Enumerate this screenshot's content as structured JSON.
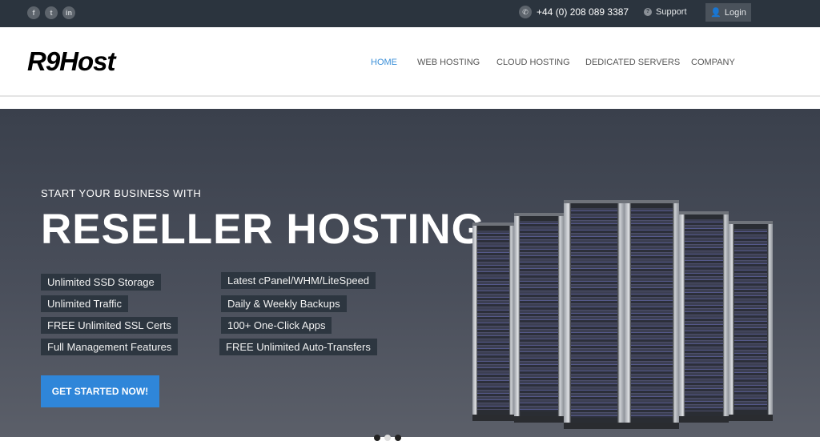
{
  "topbar": {
    "social": [
      {
        "icon": "facebook-icon",
        "glyph": "f"
      },
      {
        "icon": "twitter-icon",
        "glyph": "t"
      },
      {
        "icon": "linkedin-icon",
        "glyph": "in"
      }
    ],
    "phone": "+44 (0) 208 089 3387",
    "support": "Support",
    "login": "Login"
  },
  "header": {
    "logo": "R9Host",
    "nav": [
      "HOME",
      "WEB HOSTING",
      "CLOUD HOSTING",
      "DEDICATED SERVERS",
      "COMPANY"
    ],
    "active": "HOME",
    "accent": "#3b8fd8"
  },
  "hero": {
    "subtitle": "START YOUR BUSINESS WITH",
    "title": "RESELLER HOSTING",
    "features_left": [
      "Unlimited SSD Storage",
      "Unlimited Traffic",
      "FREE Unlimited SSL Certs",
      "Full Management Features"
    ],
    "features_right": [
      "Latest cPanel/WHM/LiteSpeed",
      "Daily & Weekly Backups",
      "100+ One-Click Apps",
      "FREE Unlimited Auto-Transfers"
    ],
    "cta": "GET STARTED NOW!",
    "cta_color": "#2f86d9",
    "slides": 3,
    "active_slide": 2
  }
}
